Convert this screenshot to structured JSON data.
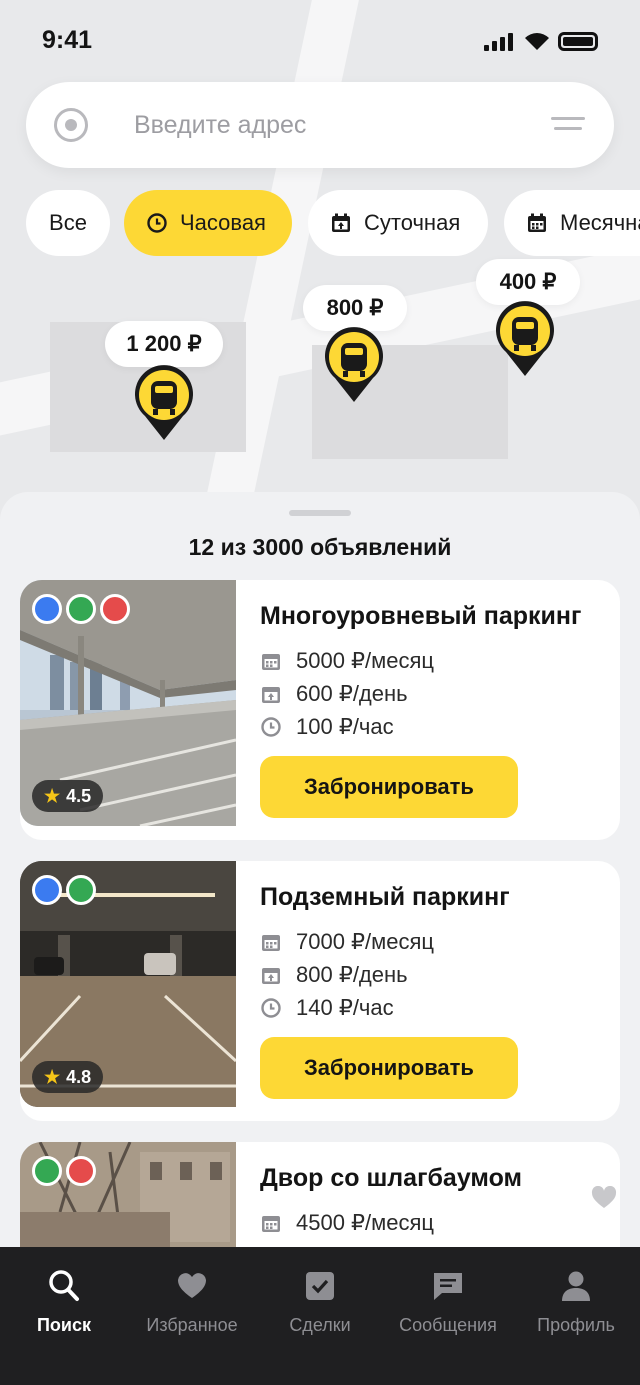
{
  "status_bar": {
    "time": "9:41"
  },
  "search": {
    "placeholder": "Введите адрес"
  },
  "chips": [
    {
      "label": "Все",
      "active": false
    },
    {
      "label": "Часовая",
      "active": true,
      "icon": "clock-icon"
    },
    {
      "label": "Суточная",
      "active": false,
      "icon": "calendar-day-icon"
    },
    {
      "label": "Месячная",
      "active": false,
      "icon": "calendar-month-icon"
    }
  ],
  "map_markers": [
    {
      "price": "1 200 ₽"
    },
    {
      "price": "800 ₽"
    },
    {
      "price": "400 ₽"
    }
  ],
  "results": {
    "count_text": "12 из 3000 объявлений"
  },
  "listings": [
    {
      "title": "Многоуровневый паркинг",
      "rating": "4.5",
      "dots": [
        "#3b7bf0",
        "#34a853",
        "#e54b4b"
      ],
      "prices": {
        "month": "5000 ₽/месяц",
        "day": "600 ₽/день",
        "hour": "100 ₽/час"
      },
      "button": "Забронировать"
    },
    {
      "title": "Подземный паркинг",
      "rating": "4.8",
      "dots": [
        "#3b7bf0",
        "#34a853"
      ],
      "prices": {
        "month": "7000 ₽/месяц",
        "day": "800 ₽/день",
        "hour": "140 ₽/час"
      },
      "button": "Забронировать"
    },
    {
      "title": "Двор со шлагбаумом",
      "dots": [
        "#34a853",
        "#e54b4b"
      ],
      "prices": {
        "month": "4500 ₽/месяц"
      }
    }
  ],
  "tabbar": {
    "search": "Поиск",
    "favorites": "Избранное",
    "deals": "Сделки",
    "messages": "Сообщения",
    "profile": "Профиль"
  },
  "colors": {
    "accent": "#fdd835",
    "tabbar_bg": "#1f1f21"
  }
}
